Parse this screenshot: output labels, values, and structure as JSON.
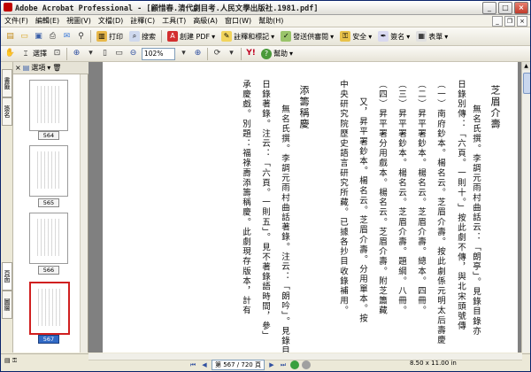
{
  "window": {
    "title": "Adobe Acrobat Professional - [顧惜春.清代劇目考.人民文學出版社.1981.pdf]",
    "buttons": {
      "minimize": "_",
      "maximize": "□",
      "close": "×"
    }
  },
  "menu": [
    "文件(F)",
    "編輯(E)",
    "視圖(V)",
    "文檔(D)",
    "註釋(C)",
    "工具(T)",
    "高級(A)",
    "窗口(W)",
    "幫助(H)"
  ],
  "toolbar1": {
    "zoom_in_label": "100%",
    "create_pdf_label": "創建 PDF",
    "comment_label": "註釋和標記",
    "review_label": "發送供審閱",
    "secure_label": "安全",
    "sign_label": "簽名",
    "forms_label": "表單",
    "print_label": "打印",
    "search_label": "搜索"
  },
  "toolbar2": {
    "select_label": "選擇",
    "zoom_value": "102%",
    "help_label": "幫助"
  },
  "sidebar": {
    "tabs": [
      "書籤",
      "簽名",
      "頁面",
      "圖層"
    ],
    "panel_title": "選項",
    "thumbnails": [
      {
        "label": "564",
        "selected": false
      },
      {
        "label": "565",
        "selected": false
      },
      {
        "label": "566",
        "selected": false
      },
      {
        "label": "567",
        "selected": true
      }
    ]
  },
  "document": {
    "columns": [
      "芝眉介壽",
      "無名氏撰。李調元雨村曲話云：「朗亭」。見錄目錄亦",
      "日錄別傳：「六頁。一則十。」按此劇不傳，與北宋頭號傳",
      "（一）南府鈔本。楊名云。芝眉介壽。按此劇係元明太后壽慶",
      "（二）昇平署鈔本。楊名云。芝眉介壽。總本。四冊。",
      "（三）昇平署鈔本。楊名云。芝眉介壽。題綱。八冊。",
      "（四）昇平署分用戲本。楊名云。芝眉介壽。附芝簫藏",
      "又，昇平署鈔本。楊名云。芝眉介壽。分用單本。按",
      "中央研究院歷史語言研究所藏。已據各抄目收錄補用。",
      "",
      "添籌稱慶",
      "無名氏撰。李調元雨村曲話著錄。注云：「朗吟」。見錄目錄亦著",
      "日錄著錄。注云：「六頁。一則五」。見不著錄語時間，參」",
      "承慶戲。別題：福祿壽添籌稱慶。此劇現存版本，計有"
    ]
  },
  "status": {
    "dimensions": "8.50 x 11.00 in",
    "page_indicator": "第 567 / 720 頁"
  }
}
